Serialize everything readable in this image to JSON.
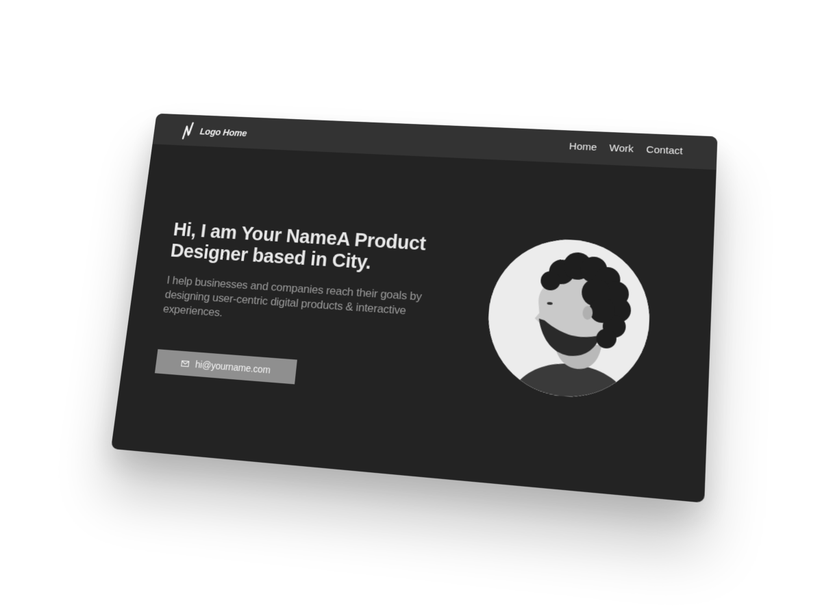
{
  "logo": {
    "text": "Logo Home",
    "icon": "zigzag-logo-icon"
  },
  "nav": {
    "links": [
      "Home",
      "Work",
      "Contact"
    ]
  },
  "hero": {
    "title": "Hi, I am Your NameA Product Designer based in City.",
    "description": "I help businesses and companies reach their goals by designing user-centric digital products & interactive experiences.",
    "cta_icon": "mail-icon",
    "cta_label": "hi@yourname.com"
  },
  "portrait": {
    "alt": "Profile portrait"
  },
  "colors": {
    "card_background": "#232323",
    "navbar_background": "#333333",
    "button_background": "#8f8f8f",
    "page_background": "#ffffff"
  }
}
